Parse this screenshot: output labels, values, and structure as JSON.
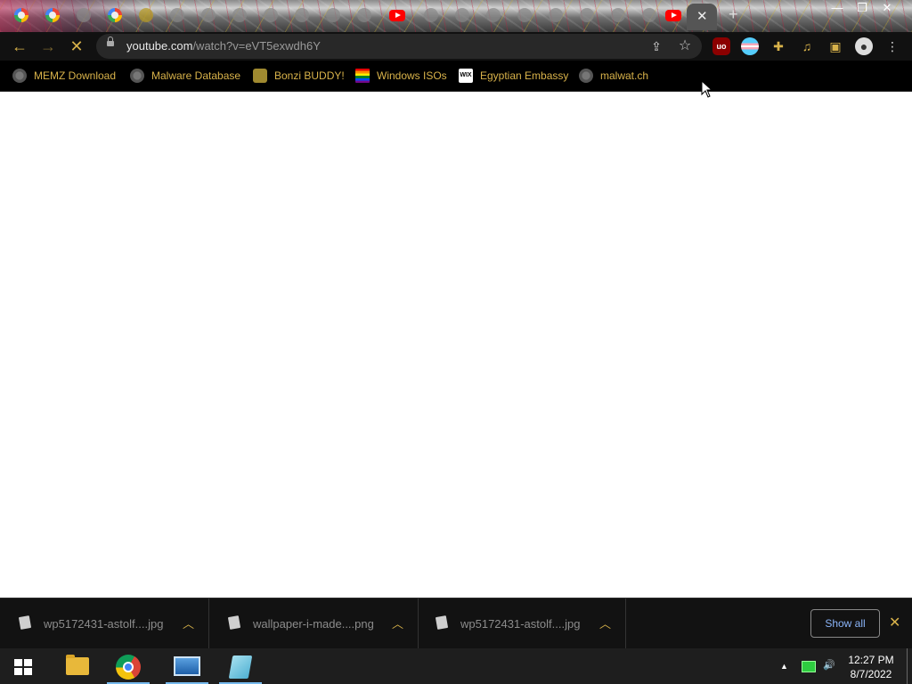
{
  "browser": {
    "url_host": "youtube.com",
    "url_path": "/watch?v=eVT5exwdh6Y"
  },
  "tabs": {
    "favicons": [
      "google",
      "google",
      "generic",
      "google",
      "generic",
      "generic",
      "generic",
      "generic",
      "generic",
      "generic",
      "generic",
      "generic",
      "generic",
      "youtube",
      "generic",
      "generic",
      "generic",
      "generic",
      "generic",
      "generic",
      "generic",
      "youtube"
    ],
    "active_close": "✕",
    "new_tab": "+"
  },
  "window_controls": {
    "minimize": "—",
    "restore": "❐",
    "close": "✕"
  },
  "toolbar": {
    "back": "←",
    "forward": "→",
    "stop": "✕",
    "share": "⇪",
    "bookmark_star": "☆",
    "extensions": [
      "ublock-origin",
      "trans-flag-extension",
      "extensions-puzzle",
      "media-control",
      "side-panel",
      "profile",
      "menu"
    ]
  },
  "bookmarks": [
    {
      "label": "MEMZ Download",
      "icon": "globe-icon"
    },
    {
      "label": "Malware Database",
      "icon": "globe-icon"
    },
    {
      "label": "Bonzi BUDDY!",
      "icon": "bonzi-icon"
    },
    {
      "label": "Windows ISOs",
      "icon": "rainbow-icon"
    },
    {
      "label": "Egyptian Embassy",
      "icon": "wix-icon"
    },
    {
      "label": "malwat.ch",
      "icon": "globe-icon"
    }
  ],
  "downloads": [
    {
      "name": "wp5172431-astolf....jpg"
    },
    {
      "name": "wallpaper-i-made....png"
    },
    {
      "name": "wp5172431-astolf....jpg"
    }
  ],
  "download_shelf": {
    "show_all": "Show all",
    "close": "✕"
  },
  "taskbar": {
    "apps": [
      "file-explorer",
      "chrome",
      "photos",
      "notepad"
    ],
    "clock_time": "12:27 PM",
    "clock_date": "8/7/2022",
    "tray_expand": "▲",
    "tray_volume": "🔊"
  },
  "colors": {
    "accent_gold": "#d8b24a",
    "link_blue": "#8ab4f8",
    "toolbar_bg": "#111111"
  }
}
